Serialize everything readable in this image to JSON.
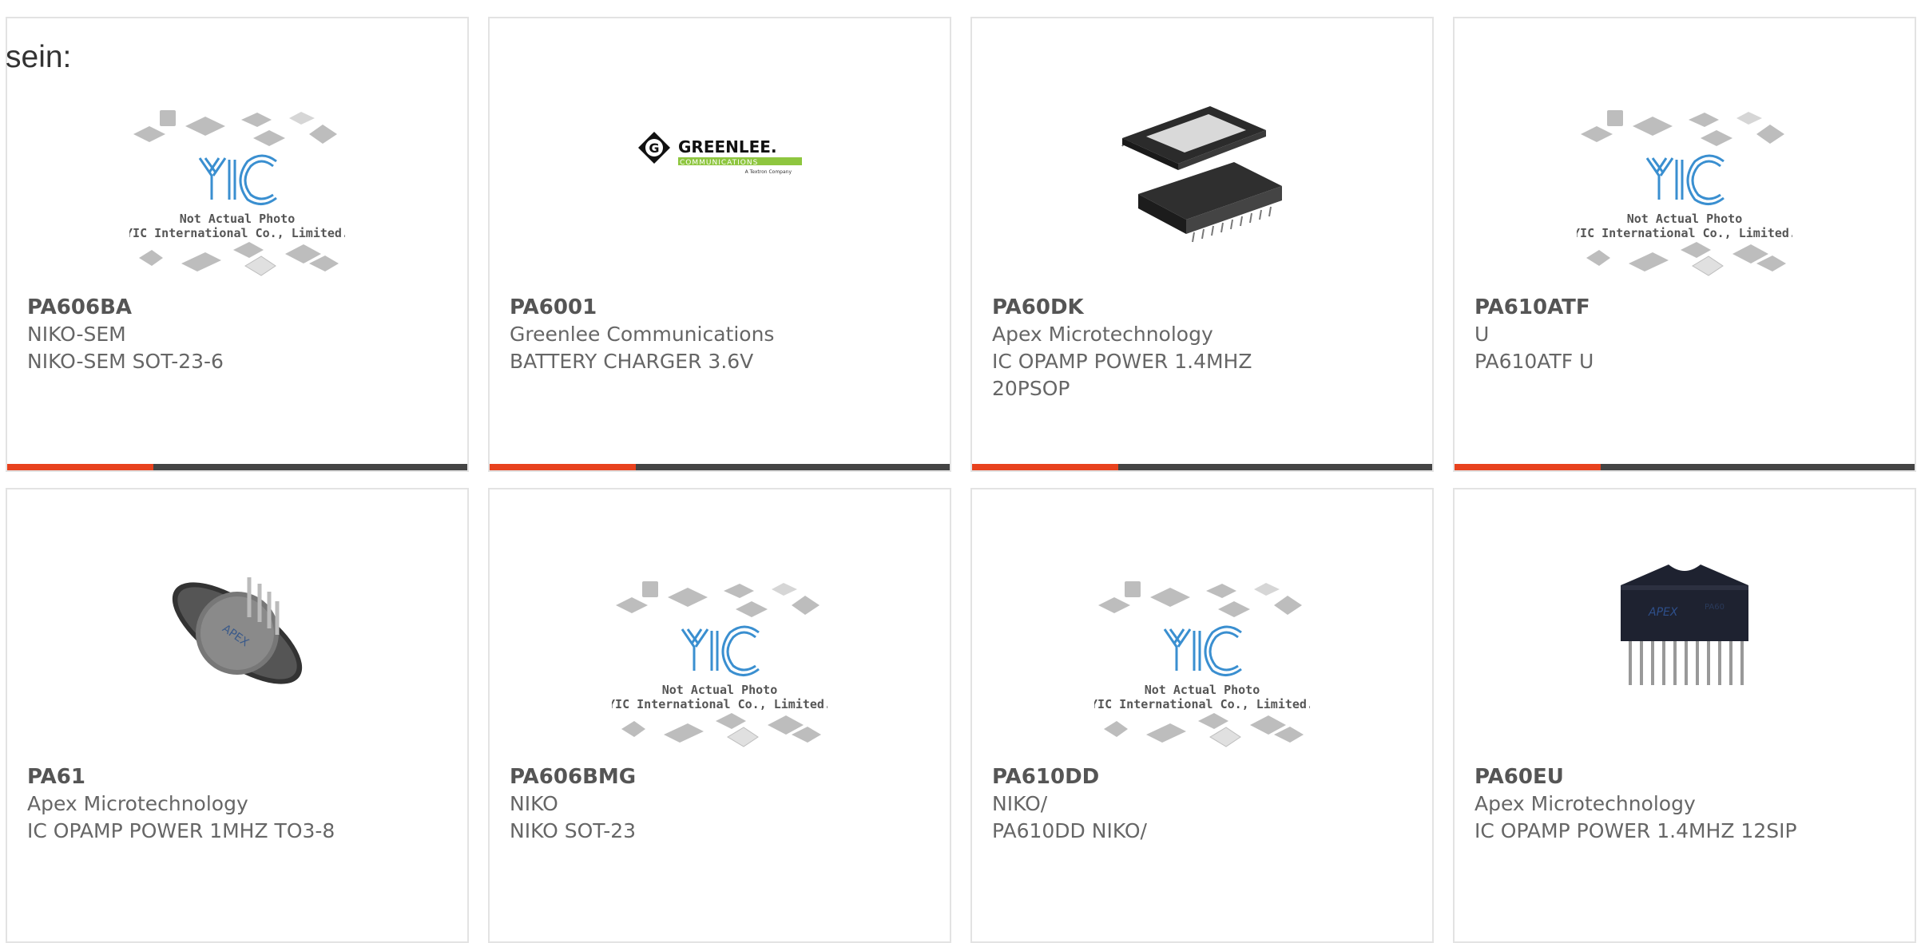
{
  "page": {
    "heading": "sein:"
  },
  "colors": {
    "accent": "#e8421e",
    "bar": "#444444",
    "border": "#e3e3e3"
  },
  "placeholder": {
    "line1": "Not Actual Photo",
    "line2": "YIC International Co., Limited.",
    "logo": "YIC"
  },
  "greenlee": {
    "brand": "GREENLEE.",
    "sub": "COMMUNICATIONS",
    "tag": "A Textron Company"
  },
  "products": [
    {
      "part": "PA606BA",
      "maker": "NIKO-SEM",
      "desc": "NIKO-SEM SOT-23-6",
      "image": "placeholder"
    },
    {
      "part": "PA6001",
      "maker": "Greenlee Communications",
      "desc": "BATTERY CHARGER 3.6V",
      "image": "greenlee-logo"
    },
    {
      "part": "PA60DK",
      "maker": "Apex Microtechnology",
      "desc": "IC OPAMP POWER 1.4MHZ 20PSOP",
      "image": "psop-chip"
    },
    {
      "part": "PA610ATF",
      "maker": "U",
      "desc": "PA610ATF U",
      "image": "placeholder"
    },
    {
      "part": "PA61",
      "maker": "Apex Microtechnology",
      "desc": "IC OPAMP POWER 1MHZ TO3-8",
      "image": "to3-can"
    },
    {
      "part": "PA606BMG",
      "maker": "NIKO",
      "desc": "NIKO SOT-23",
      "image": "placeholder"
    },
    {
      "part": "PA610DD",
      "maker": "NIKO/",
      "desc": "PA610DD NIKO/",
      "image": "placeholder"
    },
    {
      "part": "PA60EU",
      "maker": "Apex Microtechnology",
      "desc": "IC OPAMP POWER 1.4MHZ 12SIP",
      "image": "sip-chip"
    }
  ]
}
